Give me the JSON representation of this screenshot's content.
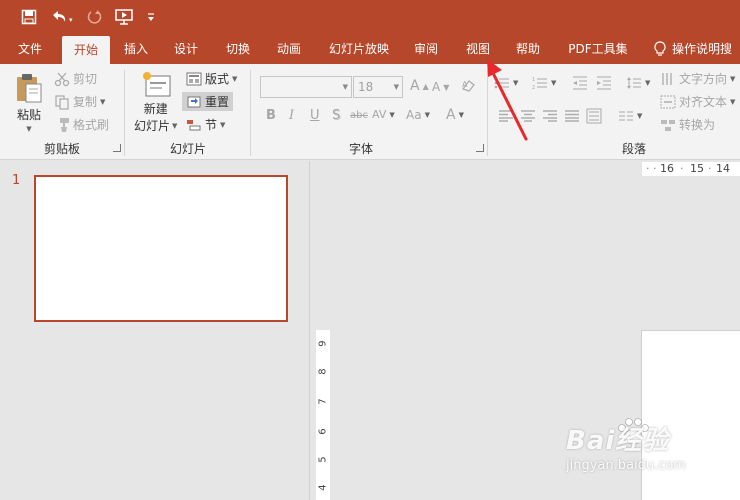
{
  "qat": {
    "save_icon": "save-icon",
    "undo_icon": "undo-icon",
    "redo_icon": "redo-icon",
    "present_icon": "present-from-start-icon",
    "customize_icon": "customize-qat-icon"
  },
  "tabs": [
    {
      "label": "文件"
    },
    {
      "label": "开始"
    },
    {
      "label": "插入"
    },
    {
      "label": "设计"
    },
    {
      "label": "切换"
    },
    {
      "label": "动画"
    },
    {
      "label": "幻灯片放映"
    },
    {
      "label": "审阅"
    },
    {
      "label": "视图"
    },
    {
      "label": "帮助"
    },
    {
      "label": "PDF工具集"
    }
  ],
  "tell_me": {
    "label": "操作说明搜"
  },
  "ribbon": {
    "clipboard": {
      "group_label": "剪贴板",
      "paste": "粘贴",
      "cut": "剪切",
      "copy": "复制",
      "format_painter": "格式刷"
    },
    "slides": {
      "group_label": "幻灯片",
      "new_slide_line1": "新建",
      "new_slide_line2": "幻灯片",
      "layout": "版式",
      "reset": "重置",
      "section": "节"
    },
    "font": {
      "group_label": "字体",
      "font_name": "",
      "font_size": "18",
      "bold": "B",
      "italic": "I",
      "underline": "U",
      "shadow": "S",
      "strike": "abc",
      "spacing": "AV",
      "change_case": "Aa",
      "grow": "A",
      "shrink": "A",
      "font_color": "A"
    },
    "paragraph": {
      "group_label": "段落",
      "text_direction": "文字方向",
      "align_text": "对齐文本",
      "convert_smartart": "转换为"
    }
  },
  "slides_pane": {
    "slide_number": "1"
  },
  "ruler": {
    "horizontal": [
      "16",
      "15",
      "14"
    ],
    "vertical": [
      "9",
      "8",
      "7",
      "6",
      "5",
      "4"
    ]
  },
  "watermark": {
    "brand": "Bai经验",
    "url": "jingyan.baidu.com"
  },
  "colors": {
    "accent": "#b7472a",
    "ribbon_bg": "#f3f3f3",
    "workspace_bg": "#e6e6e6",
    "arrow": "#e8282b"
  }
}
